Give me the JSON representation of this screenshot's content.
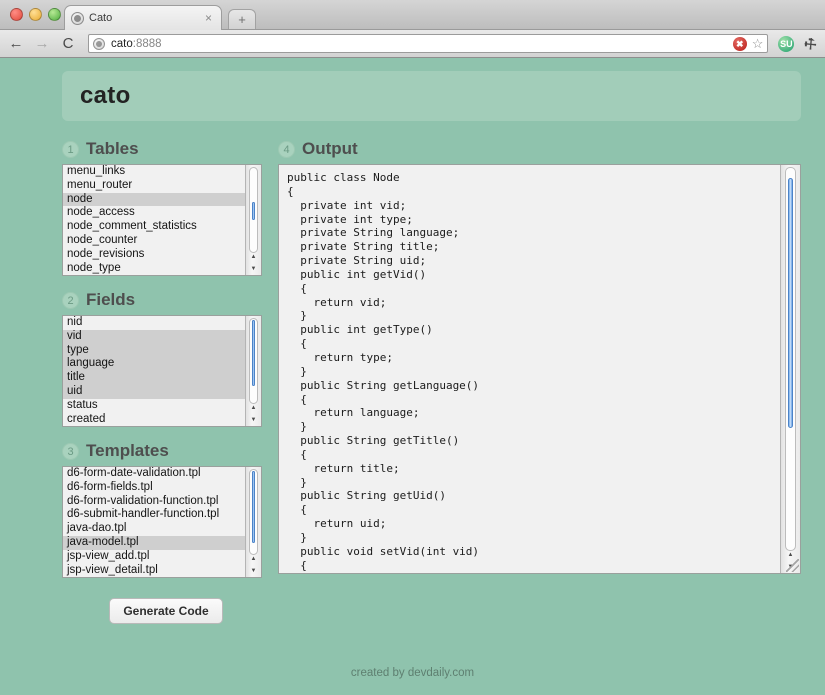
{
  "browser": {
    "tab_title": "Cato",
    "tab_close": "×",
    "new_tab": "+",
    "back": "←",
    "forward": "→",
    "reload": "C",
    "url_host": "cato",
    "url_port": ":8888",
    "block_badge": "✖",
    "bookmark_star": "☆",
    "stumbleupon": "SU",
    "wrench": "⚒"
  },
  "app": {
    "title": "cato",
    "footer": "created by devdaily.com"
  },
  "sections": {
    "tables": {
      "num": "1",
      "title": "Tables"
    },
    "fields": {
      "num": "2",
      "title": "Fields"
    },
    "templates": {
      "num": "3",
      "title": "Templates"
    },
    "output": {
      "num": "4",
      "title": "Output"
    }
  },
  "tables": {
    "items": [
      {
        "label": "menu_links",
        "selected": false
      },
      {
        "label": "menu_router",
        "selected": false
      },
      {
        "label": "node",
        "selected": true
      },
      {
        "label": "node_access",
        "selected": false
      },
      {
        "label": "node_comment_statistics",
        "selected": false
      },
      {
        "label": "node_counter",
        "selected": false
      },
      {
        "label": "node_revisions",
        "selected": false
      },
      {
        "label": "node_type",
        "selected": false
      }
    ]
  },
  "fields": {
    "items": [
      {
        "label": "nid",
        "selected": false
      },
      {
        "label": "vid",
        "selected": true
      },
      {
        "label": "type",
        "selected": true
      },
      {
        "label": "language",
        "selected": true
      },
      {
        "label": "title",
        "selected": true
      },
      {
        "label": "uid",
        "selected": true
      },
      {
        "label": "status",
        "selected": false
      },
      {
        "label": "created",
        "selected": false
      }
    ]
  },
  "templates": {
    "items": [
      {
        "label": "d6-form-date-validation.tpl",
        "selected": false
      },
      {
        "label": "d6-form-fields.tpl",
        "selected": false
      },
      {
        "label": "d6-form-validation-function.tpl",
        "selected": false
      },
      {
        "label": "d6-submit-handler-function.tpl",
        "selected": false
      },
      {
        "label": "java-dao.tpl",
        "selected": false
      },
      {
        "label": "java-model.tpl",
        "selected": true
      },
      {
        "label": "jsp-view_add.tpl",
        "selected": false
      },
      {
        "label": "jsp-view_detail.tpl",
        "selected": false
      }
    ]
  },
  "output": {
    "code": "public class Node\n{\n  private int vid;\n  private int type;\n  private String language;\n  private String title;\n  private String uid;\n  public int getVid()\n  {\n    return vid;\n  }\n  public int getType()\n  {\n    return type;\n  }\n  public String getLanguage()\n  {\n    return language;\n  }\n  public String getTitle()\n  {\n    return title;\n  }\n  public String getUid()\n  {\n    return uid;\n  }\n  public void setVid(int vid)\n  {\n    this.vid = vid;\n  }\n  public void setType(int type)"
  },
  "actions": {
    "generate": "Generate Code"
  }
}
